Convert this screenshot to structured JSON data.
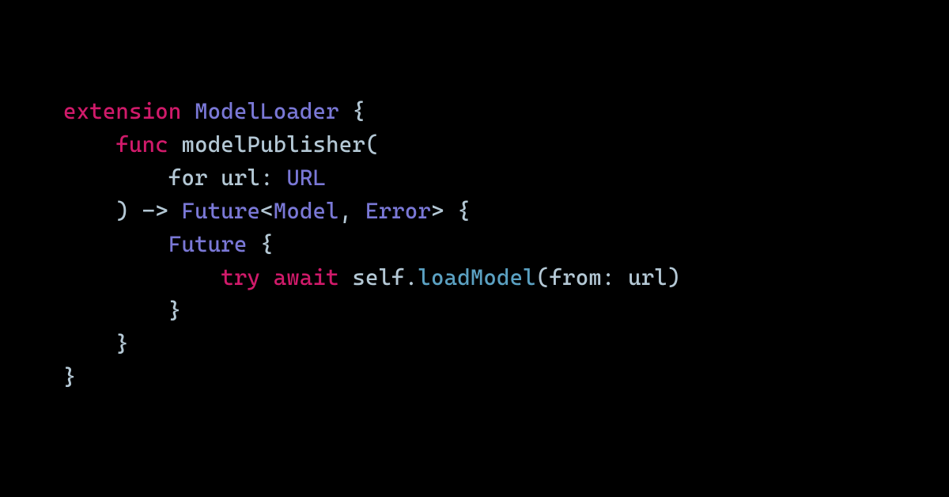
{
  "code": {
    "l1": {
      "kw": "extension",
      "type": "ModelLoader",
      "brace": "{"
    },
    "l2": {
      "kw": "func",
      "name": "modelPublisher",
      "paren": "("
    },
    "l3": {
      "label": "for",
      "param": "url",
      "colon": ":",
      "type": "URL"
    },
    "l4": {
      "paren": ")",
      "arrow": "->",
      "type1": "Future",
      "lt": "<",
      "g1": "Model",
      "comma": ",",
      "g2": "Error",
      "gt": ">",
      "brace": "{"
    },
    "l5": {
      "type": "Future",
      "brace": "{"
    },
    "l6": {
      "kw1": "try",
      "kw2": "await",
      "self": "self",
      "dot": ".",
      "method": "loadModel",
      "paren1": "(",
      "label": "from",
      "colon": ":",
      "arg": "url",
      "paren2": ")"
    },
    "l7": {
      "brace": "}"
    },
    "l8": {
      "brace": "}"
    },
    "l9": {
      "brace": "}"
    }
  },
  "colors": {
    "background": "#000000",
    "keyword": "#d01a6a",
    "type": "#7a78d6",
    "identifier": "#b4c8d5",
    "method": "#5ba1c2"
  }
}
